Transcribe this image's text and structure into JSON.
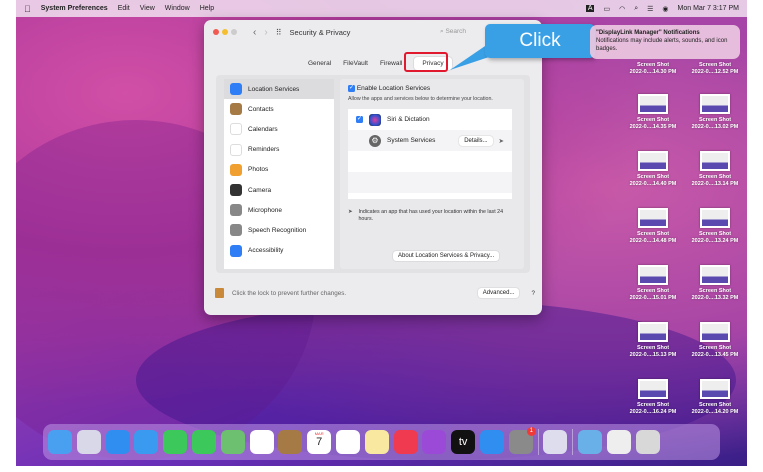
{
  "menubar": {
    "app": "System Preferences",
    "items": [
      "Edit",
      "View",
      "Window",
      "Help"
    ],
    "clock": "Mon Mar 7  3:17 PM"
  },
  "window": {
    "title": "Security & Privacy",
    "search_placeholder": "Search",
    "tabs": [
      {
        "label": "General"
      },
      {
        "label": "FileVault"
      },
      {
        "label": "Firewall"
      },
      {
        "label": "Privacy",
        "selected": true
      }
    ],
    "sidebar": [
      {
        "label": "Location Services",
        "icon": "location-arrow-icon",
        "color": "#2f7ef6"
      },
      {
        "label": "Contacts",
        "icon": "contacts-icon",
        "color": "#a57a45"
      },
      {
        "label": "Calendars",
        "icon": "calendar-icon",
        "color": "#ffffff"
      },
      {
        "label": "Reminders",
        "icon": "reminders-icon",
        "color": "#ffffff"
      },
      {
        "label": "Photos",
        "icon": "photos-icon",
        "color": "#f0a030"
      },
      {
        "label": "Camera",
        "icon": "camera-icon",
        "color": "#333333"
      },
      {
        "label": "Microphone",
        "icon": "microphone-icon",
        "color": "#888888"
      },
      {
        "label": "Speech Recognition",
        "icon": "waveform-icon",
        "color": "#888888"
      },
      {
        "label": "Accessibility",
        "icon": "accessibility-icon",
        "color": "#2f7ef6"
      }
    ],
    "enable_label": "Enable Location Services",
    "enable_checked": true,
    "allow_text": "Allow the apps and services below to determine your location.",
    "apps": [
      {
        "label": "Siri & Dictation",
        "checked": true
      },
      {
        "label": "System Services",
        "details": "Details..."
      }
    ],
    "legend_text": "Indicates an app that has used your location within the last 24 hours.",
    "about_button": "About Location Services & Privacy...",
    "lock_text": "Click the lock to prevent further changes.",
    "advanced_button": "Advanced...",
    "help_button": "?"
  },
  "callout": {
    "label": "Click",
    "color": "#3aa0e6"
  },
  "notification": {
    "title": "\"DisplayLink Manager\" Notifications",
    "body": "Notifications may include alerts, sounds, and icon badges."
  },
  "desktop_files": [
    {
      "name": "Screen Shot",
      "date": "2022-0....14.30 PM"
    },
    {
      "name": "Screen Shot",
      "date": "2022-0....12.52 PM"
    },
    {
      "name": "Screen Shot",
      "date": "2022-0....14.35 PM"
    },
    {
      "name": "Screen Shot",
      "date": "2022-0....13.02 PM"
    },
    {
      "name": "Screen Shot",
      "date": "2022-0....14.40 PM"
    },
    {
      "name": "Screen Shot",
      "date": "2022-0....13.14 PM"
    },
    {
      "name": "Screen Shot",
      "date": "2022-0....14.48 PM"
    },
    {
      "name": "Screen Shot",
      "date": "2022-0....13.24 PM"
    },
    {
      "name": "Screen Shot",
      "date": "2022-0....15.01 PM"
    },
    {
      "name": "Screen Shot",
      "date": "2022-0....13.32 PM"
    },
    {
      "name": "Screen Shot",
      "date": "2022-0....15.13 PM"
    },
    {
      "name": "Screen Shot",
      "date": "2022-0....13.45 PM"
    },
    {
      "name": "Screen Shot",
      "date": "2022-0....16.24 PM"
    },
    {
      "name": "Screen Shot",
      "date": "2022-0....14.20 PM"
    }
  ],
  "dock": [
    {
      "name": "finder",
      "color": "#4aa0f0"
    },
    {
      "name": "launchpad",
      "color": "#d8d8e8"
    },
    {
      "name": "safari",
      "color": "#2f8ef0"
    },
    {
      "name": "mail",
      "color": "#3a9af0"
    },
    {
      "name": "facetime",
      "color": "#3cc85a"
    },
    {
      "name": "messages",
      "color": "#3cc85a"
    },
    {
      "name": "maps",
      "color": "#6cc070"
    },
    {
      "name": "photos",
      "color": "#ffffff"
    },
    {
      "name": "contacts",
      "color": "#a57a45"
    },
    {
      "name": "calendar",
      "color": "#ffffff",
      "text": "7",
      "month": "MAR"
    },
    {
      "name": "reminders",
      "color": "#ffffff"
    },
    {
      "name": "notes",
      "color": "#f8e8a0"
    },
    {
      "name": "music",
      "color": "#f03a50"
    },
    {
      "name": "podcasts",
      "color": "#9b4ad8"
    },
    {
      "name": "tv",
      "color": "#111111",
      "text": "tv"
    },
    {
      "name": "app-store",
      "color": "#2f8ef0"
    },
    {
      "name": "system-preferences",
      "color": "#8a8a8a",
      "badge": "1"
    },
    {
      "name": "preview",
      "color": "#dde"
    },
    {
      "name": "folder",
      "color": "#6ab0e8"
    },
    {
      "name": "document",
      "color": "#eeeeee"
    },
    {
      "name": "trash",
      "color": "#d8d8d8"
    }
  ]
}
